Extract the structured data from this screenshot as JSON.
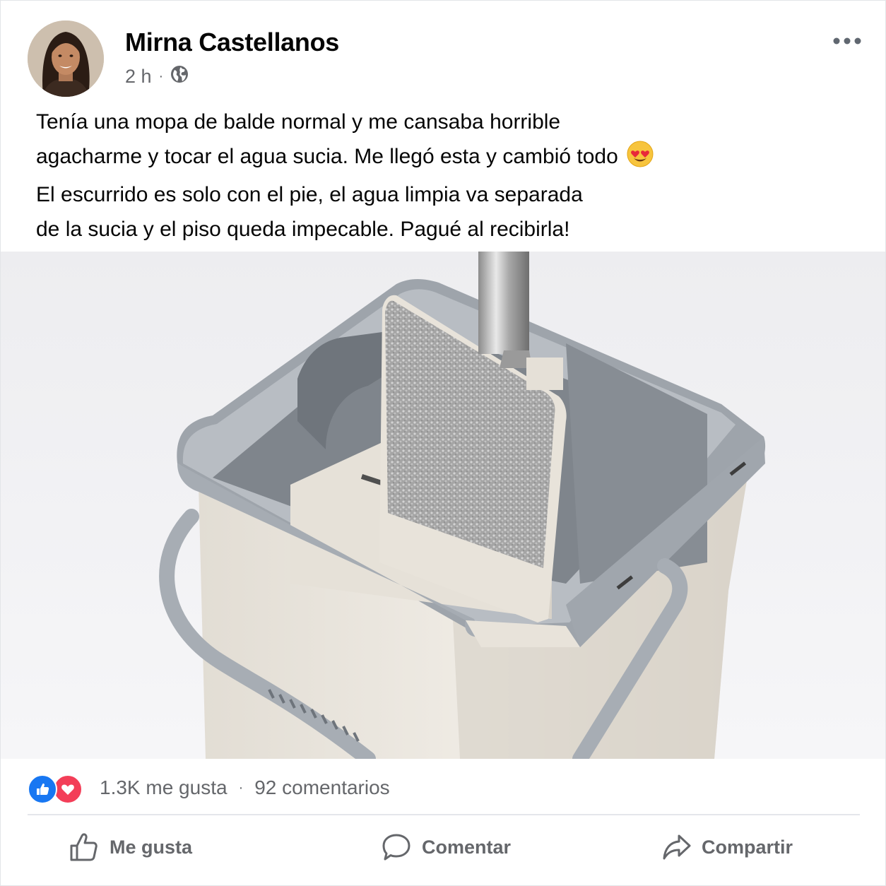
{
  "post": {
    "author": "Mirna Castellanos",
    "time": "2 h",
    "separator": "·",
    "audience_icon": "globe-icon",
    "more_icon": "more-horizontal-icon",
    "text_lines": [
      "Tenía una mopa de balde normal y me cansaba horrible",
      "agacharme y tocar el agua sucia. Me llegó esta y cambió todo",
      "El escurrido es solo con el pie, el agua limpia va separada",
      "de la sucia y el piso queda impecable. Pagué al recibirla!"
    ],
    "emoji_icon": "heart-eyes-emoji-icon",
    "photo": "flat mop and bucket with separated compartments"
  },
  "engagement": {
    "reaction_icons": [
      "like-reaction-icon",
      "love-reaction-icon"
    ],
    "likes": "1.3K me gusta",
    "separator": "·",
    "comments": "92 comentarios"
  },
  "actions": {
    "like": "Me gusta",
    "comment": "Comentar",
    "share": "Compartir"
  },
  "colors": {
    "like_blue": "#1877f2",
    "love_red": "#f33e58",
    "secondary_text": "#65676b",
    "primary_text": "#050505"
  }
}
